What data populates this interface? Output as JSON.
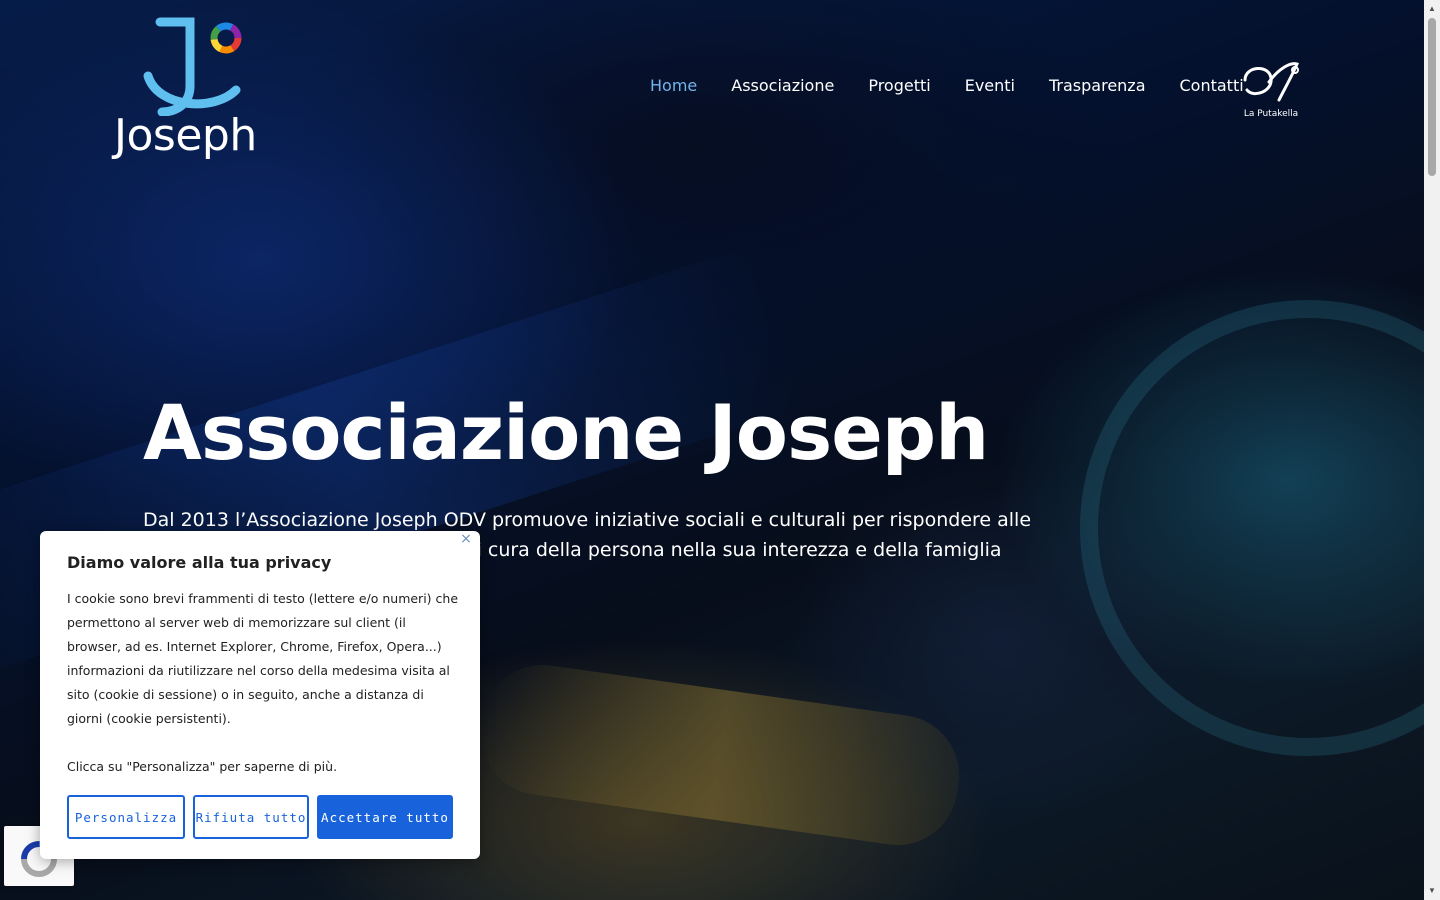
{
  "header": {
    "logo_text": "Joseph",
    "nav": [
      {
        "label": "Home",
        "active": true
      },
      {
        "label": "Associazione",
        "active": false
      },
      {
        "label": "Progetti",
        "active": false
      },
      {
        "label": "Eventi",
        "active": false
      },
      {
        "label": "Trasparenza",
        "active": false
      },
      {
        "label": "Contatti",
        "active": false
      }
    ],
    "partner_logo_text": "La Putakella"
  },
  "hero": {
    "title": "Associazione Joseph",
    "text": "Dal 2013 l’Associazione Joseph ODV promuove iniziative sociali e culturali per rispondere alle esigenze del territorio, prendendosi cura della persona nella sua interezza e della famiglia"
  },
  "cookie_banner": {
    "close_symbol": "×",
    "title": "Diamo valore alla tua privacy",
    "paragraph_1": "I cookie sono brevi frammenti di testo (lettere e/o numeri) che permettono al server web di memorizzare sul client (il browser, ad es. Internet Explorer, Chrome, Firefox, Opera...) informazioni da riutilizzare nel corso della medesima visita al sito (cookie di sessione) o in seguito, anche a distanza di giorni (cookie persistenti).",
    "paragraph_2": "Clicca su \"Personalizza\" per saperne di più.",
    "btn_customize": "Personalizza",
    "btn_reject": "Rifiuta tutto",
    "btn_accept": "Accettare tutto"
  },
  "colors": {
    "nav_active": "#72b4ec",
    "cookie_button": "#1863dc",
    "logo_blue": "#5fc0f0"
  },
  "icons": {
    "recaptcha": "recaptcha-icon",
    "scroll_up": "scroll-up-arrow-icon",
    "scroll_down": "scroll-down-arrow-icon"
  }
}
